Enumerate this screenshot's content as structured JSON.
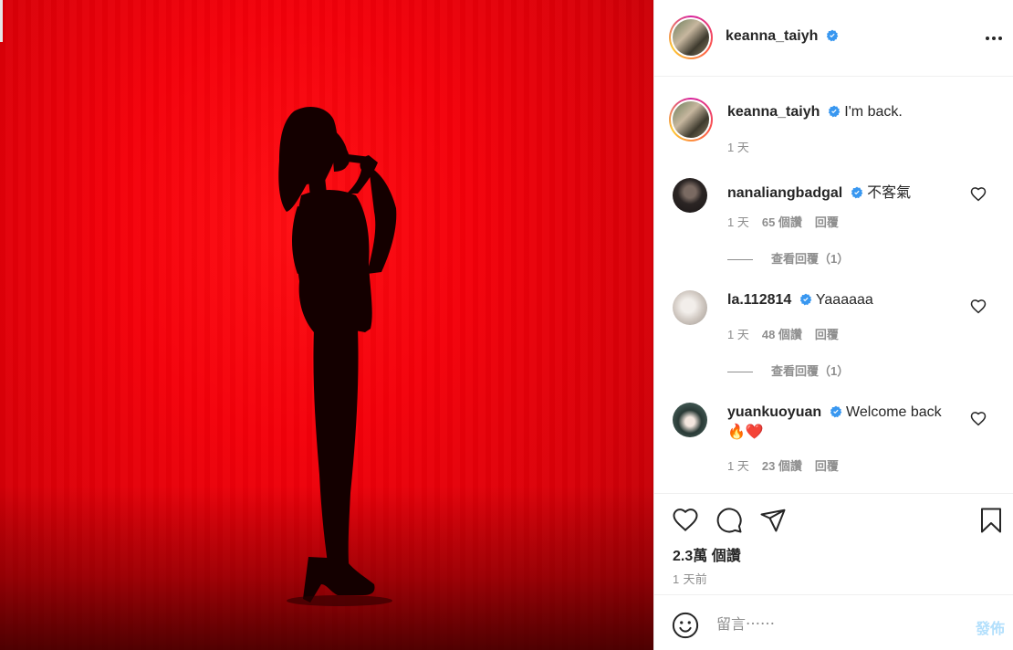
{
  "post": {
    "author": "keanna_taiyh",
    "caption_author": "keanna_taiyh",
    "caption_text": "I'm back.",
    "caption_time": "1 天"
  },
  "comments": [
    {
      "user": "nanaliangbadgal",
      "text": "不客氣",
      "time": "1 天",
      "likes": "65 個讚",
      "reply": "回覆",
      "view_replies": "查看回覆（1）"
    },
    {
      "user": "la.112814",
      "text": "Yaaaaaa",
      "time": "1 天",
      "likes": "48 個讚",
      "reply": "回覆",
      "view_replies": "查看回覆（1）"
    },
    {
      "user": "yuankuoyuan",
      "text_line1": "Welcome back",
      "text_line2": "🔥❤️",
      "time": "1 天",
      "likes": "23 個讚",
      "reply": "回覆"
    }
  ],
  "footer": {
    "like_count": "2.3萬 個讚",
    "posted_time": "1 天前",
    "comment_placeholder": "留言⋯⋯",
    "post_button": "發佈"
  },
  "icons": {
    "header": [
      "more-icon"
    ],
    "actions": [
      "heart-icon",
      "comment-icon",
      "share-icon",
      "bookmark-icon"
    ],
    "comment_box": [
      "emoji-icon"
    ]
  },
  "colors": {
    "photo_red": "#f4000a",
    "verified_blue": "#3897f0",
    "post_button_disabled": "#b2dffc",
    "secondary_text": "#8e8e8e"
  }
}
